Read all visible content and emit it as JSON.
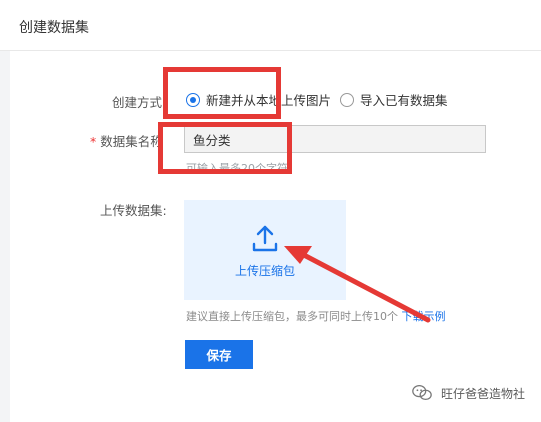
{
  "header": {
    "title": "创建数据集"
  },
  "form": {
    "create_method_label": "创建方式",
    "options": [
      {
        "label": "新建并从本地上传图片",
        "checked": true
      },
      {
        "label": "导入已有数据集",
        "checked": false
      }
    ],
    "name_label": "数据集名称",
    "name_value": "鱼分类",
    "name_hint": "可输入最多20个字符",
    "upload_label": "上传数据集:",
    "upload_text": "上传压缩包",
    "suggest_text": "建议直接上传压缩包，最多可同时上传10个",
    "download_example": "下载示例",
    "save_label": "保存"
  },
  "watermark": {
    "text": "旺仔爸爸造物社"
  },
  "colors": {
    "accent": "#1a73e8",
    "annotation_red": "#e53935",
    "upload_bg": "#e9f3ff"
  }
}
